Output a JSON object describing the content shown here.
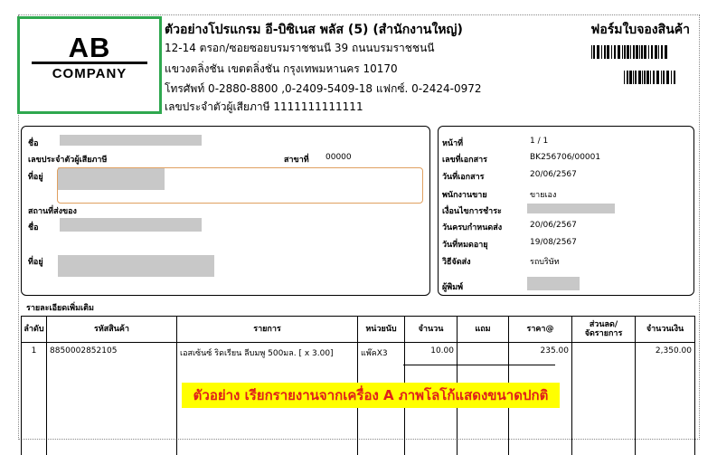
{
  "logo": {
    "top": "AB",
    "bottom": "COMPANY"
  },
  "company": {
    "name": "ตัวอย่างโปรแกรม อี-บิซิเนส พลัส (5) (สำนักงานใหญ่)",
    "address1": "12-14 ตรอก/ซอยซอยบรมราชชนนี 39 ถนนบรมราชชนนี",
    "address2": "แขวงตลิ่งชัน เขตตลิ่งชัน กรุงเทพมหานคร 10170",
    "phone": "โทรศัพท์ 0-2880-8800 ,0-2409-5409-18  แฟกซ์. 0-2424-0972",
    "tax_id": "เลขประจำตัวผู้เสียภาษี    1111111111111"
  },
  "form_title": "ฟอร์มใบจองสินค้า",
  "customer": {
    "name_label": "ชื่อ",
    "tax_label": "เลขประจำตัวผู้เสียภาษี",
    "branch_label": "สาขาที่",
    "branch_value": "00000",
    "address_label": "ที่อยู่",
    "ship_label": "สถานที่ส่งของ",
    "ship_name_label": "ชื่อ",
    "ship_address_label": "ที่อยู่"
  },
  "doc_info": {
    "page_label": "หน้าที่",
    "page_value": "1  /  1",
    "doc_no_label": "เลขที่เอกสาร",
    "doc_no_value": "BK256706/00001",
    "date_label": "วันที่เอกสาร",
    "date_value": "20/06/2567",
    "sales_label": "พนักงานขาย",
    "sales_value": "ขายเอง",
    "terms_label": "เงื่อนไขการชำระ",
    "due_label": "วันครบกำหนดส่ง",
    "due_value": "20/06/2567",
    "expire_label": "วันที่หมดอายุ",
    "expire_value": "19/08/2567",
    "ship_method_label": "วิธีจัดส่ง",
    "ship_method_value": "รถบริษัท",
    "printer_label": "ผู้พิมพ์"
  },
  "details_label": "รายละเอียดเพิ่มเติม",
  "table": {
    "headers": [
      "ลำดับ",
      "รหัสสินค้า",
      "รายการ",
      "หน่วยนับ",
      "จำนวน",
      "แถม",
      "ราคา@",
      "ส่วนลด/\nจัดรายการ",
      "จำนวนเงิน"
    ],
    "rows": [
      [
        "1",
        "8850002852105",
        "เอสเซ้นซ์ ริดเรียน ลีบมพู 500มล. [ x 3.00]",
        "แพ๊คX3",
        "10.00",
        "",
        "235.00",
        "",
        "2,350.00"
      ]
    ]
  },
  "banner": "ตัวอย่าง เรียกรายงานจากเครื่อง A ภาพโลโก้แสดงขนาดปกติ",
  "colors": {
    "logo_border": "#2fa84f",
    "banner_bg": "#ffff00",
    "banner_text": "#e0201a"
  }
}
